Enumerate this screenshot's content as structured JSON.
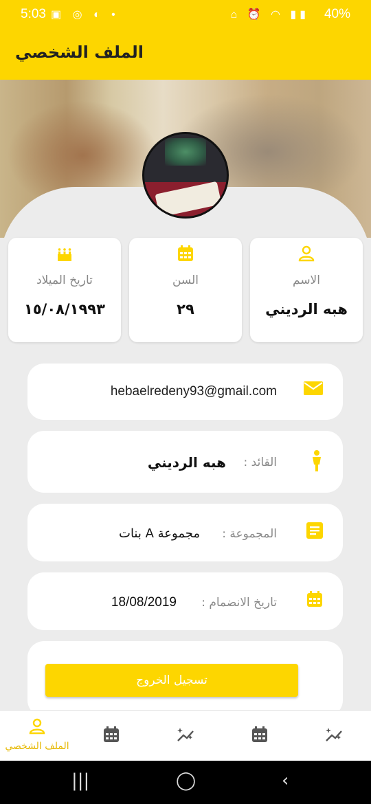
{
  "status_bar": {
    "time": "5:03",
    "battery": "40%",
    "left_icons": "▣ ◎ ◐ •",
    "right_icons": "⌂ ⏰ ◠ ▮▮"
  },
  "app_bar": {
    "title": "الملف الشخصي"
  },
  "info_cards": {
    "name": {
      "label": "الاسم",
      "value": "هبه الرديني",
      "icon": "person-icon"
    },
    "age": {
      "label": "السن",
      "value": "٢٩",
      "icon": "calendar-icon"
    },
    "birth": {
      "label": "تاريخ الميلاد",
      "value": "١٥/٠٨/١٩٩٣",
      "icon": "cake-icon"
    }
  },
  "details": {
    "email": {
      "value": "hebaelredeny93@gmail.com",
      "icon": "mail-icon"
    },
    "leader": {
      "label": "القائد :",
      "value": "هبه الرديني",
      "icon": "leader-icon"
    },
    "group": {
      "label": "المجموعة :",
      "value": "مجموعة A بنات",
      "icon": "list-icon"
    },
    "joined": {
      "label": "تاريخ الانضمام :",
      "value": "18/08/2019",
      "icon": "calendar-icon"
    }
  },
  "logout": {
    "label": "تسجيل الخروج"
  },
  "bottom_nav": {
    "profile_label": "الملف الشخصي",
    "items": [
      "person-icon",
      "calendar-icon",
      "sparkle-icon",
      "calendar-icon",
      "sparkle-icon"
    ]
  },
  "colors": {
    "accent": "#fdd600",
    "background": "#ececec",
    "card": "#ffffff"
  }
}
